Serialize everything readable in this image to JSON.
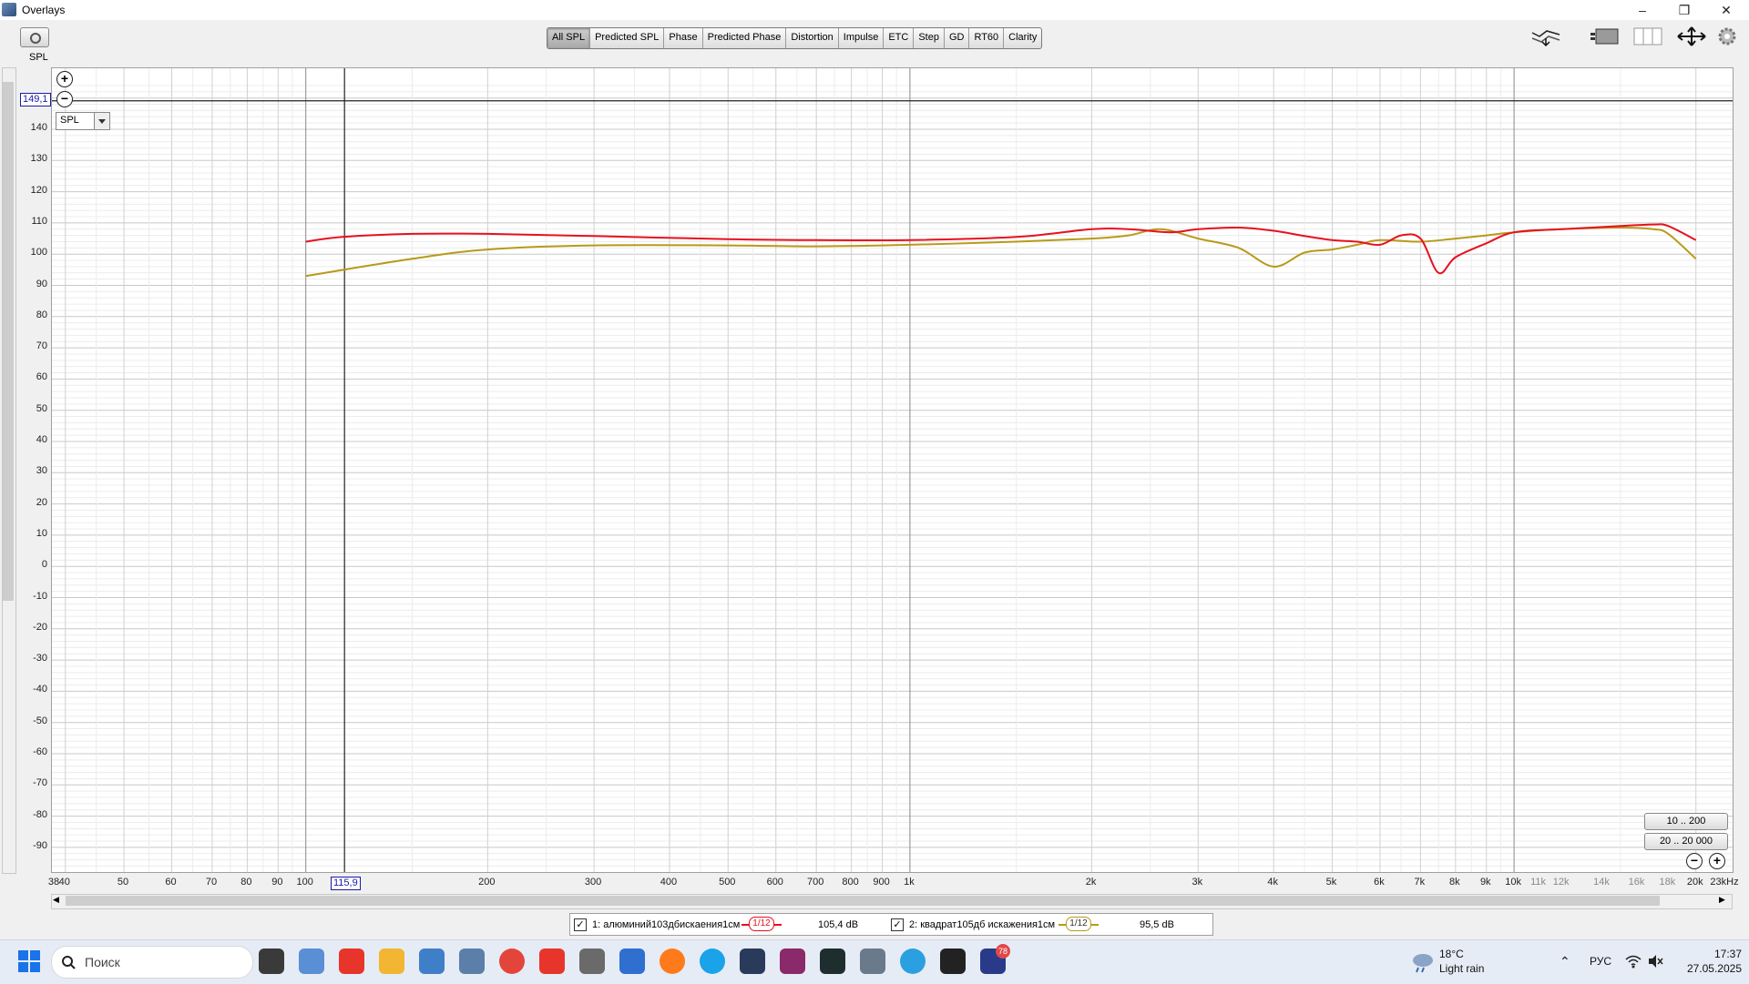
{
  "window": {
    "title": "Overlays"
  },
  "toolbar": {
    "graph_label": "SPL",
    "tabs": [
      {
        "label": "All SPL",
        "active": true
      },
      {
        "label": "Predicted SPL"
      },
      {
        "label": "Phase"
      },
      {
        "label": "Predicted Phase"
      },
      {
        "label": "Distortion"
      },
      {
        "label": "Impulse"
      },
      {
        "label": "ETC"
      },
      {
        "label": "Step"
      },
      {
        "label": "GD"
      },
      {
        "label": "RT60"
      },
      {
        "label": "Clarity"
      }
    ]
  },
  "graph": {
    "cursor_value": "149,1",
    "cursor_freq": "115,9",
    "dropdown_value": "SPL",
    "range_buttons": [
      "10 .. 200",
      "20 .. 20 000"
    ]
  },
  "chart_data": {
    "type": "line",
    "x_scale": "log",
    "xlim": [
      38,
      23000
    ],
    "ylim": [
      -100,
      155
    ],
    "grid": true,
    "yticks": [
      "140",
      "130",
      "120",
      "110",
      "100",
      "90",
      "80",
      "70",
      "60",
      "50",
      "40",
      "30",
      "20",
      "10",
      "0",
      "-10",
      "-20",
      "-30",
      "-40",
      "-50",
      "-60",
      "-70",
      "-80",
      "-90"
    ],
    "xtick_labels": [
      {
        "f": 38,
        "t": "38",
        "minor": false
      },
      {
        "f": 40,
        "t": "40",
        "minor": false
      },
      {
        "f": 50,
        "t": "50",
        "minor": false
      },
      {
        "f": 60,
        "t": "60",
        "minor": false
      },
      {
        "f": 70,
        "t": "70",
        "minor": false
      },
      {
        "f": 80,
        "t": "80",
        "minor": false
      },
      {
        "f": 90,
        "t": "90",
        "minor": false
      },
      {
        "f": 100,
        "t": "100",
        "minor": false
      },
      {
        "f": 200,
        "t": "200",
        "minor": false
      },
      {
        "f": 300,
        "t": "300",
        "minor": false
      },
      {
        "f": 400,
        "t": "400",
        "minor": false
      },
      {
        "f": 500,
        "t": "500",
        "minor": false
      },
      {
        "f": 600,
        "t": "600",
        "minor": false
      },
      {
        "f": 700,
        "t": "700",
        "minor": false
      },
      {
        "f": 800,
        "t": "800",
        "minor": false
      },
      {
        "f": 900,
        "t": "900",
        "minor": false
      },
      {
        "f": 1000,
        "t": "1k",
        "minor": false
      },
      {
        "f": 2000,
        "t": "2k",
        "minor": false
      },
      {
        "f": 3000,
        "t": "3k",
        "minor": false
      },
      {
        "f": 4000,
        "t": "4k",
        "minor": false
      },
      {
        "f": 5000,
        "t": "5k",
        "minor": false
      },
      {
        "f": 6000,
        "t": "6k",
        "minor": false
      },
      {
        "f": 7000,
        "t": "7k",
        "minor": false
      },
      {
        "f": 8000,
        "t": "8k",
        "minor": false
      },
      {
        "f": 9000,
        "t": "9k",
        "minor": false
      },
      {
        "f": 10000,
        "t": "10k",
        "minor": false
      },
      {
        "f": 11000,
        "t": "11k",
        "minor": true
      },
      {
        "f": 12000,
        "t": "12k",
        "minor": true
      },
      {
        "f": 14000,
        "t": "14k",
        "minor": true
      },
      {
        "f": 16000,
        "t": "16k",
        "minor": true
      },
      {
        "f": 18000,
        "t": "18k",
        "minor": true
      },
      {
        "f": 20000,
        "t": "20k",
        "minor": false
      },
      {
        "f": 23000,
        "t": "23kHz",
        "minor": false
      }
    ],
    "series": [
      {
        "name": "1: алюминий103дбискаения1см",
        "color": "#e8101e",
        "x": [
          100,
          115,
          150,
          200,
          300,
          500,
          700,
          1000,
          1500,
          2000,
          2300,
          2700,
          3000,
          3500,
          4000,
          4500,
          5000,
          5500,
          6000,
          6500,
          7000,
          7500,
          8000,
          9000,
          10000,
          12000,
          15000,
          17000,
          18000,
          20000
        ],
        "y": [
          104,
          105.5,
          106.5,
          106.5,
          105.8,
          104.8,
          104.5,
          104.5,
          105.5,
          108,
          108,
          107,
          108,
          108.5,
          107.5,
          105.8,
          104.5,
          104,
          103,
          106,
          105,
          94,
          99,
          103.5,
          107,
          108,
          109,
          109.5,
          109,
          104.5
        ]
      },
      {
        "name": "2: квадрат105дб искажения1см",
        "color": "#b89a1a",
        "x": [
          100,
          150,
          200,
          300,
          500,
          700,
          1000,
          1500,
          2000,
          2300,
          2600,
          3000,
          3500,
          4000,
          4500,
          5000,
          5500,
          6000,
          7000,
          8000,
          9000,
          10000,
          12000,
          15000,
          17000,
          18000,
          20000
        ],
        "y": [
          93,
          98.5,
          101.5,
          102.8,
          102.8,
          102.5,
          103,
          104,
          105,
          106,
          108,
          105,
          102,
          96,
          100.5,
          101.5,
          103,
          104.5,
          104,
          105,
          106,
          107,
          108,
          108.5,
          108,
          106.5,
          98.5
        ]
      }
    ]
  },
  "legend": [
    {
      "check": "✓",
      "label": "1: алюминий103дбискаения1см",
      "smoothing": "1/12",
      "value": "105,4 dB",
      "color": "#e8101e"
    },
    {
      "check": "✓",
      "label": "2: квадрат105дб искажения1см",
      "smoothing": "1/12",
      "value": "95,5 dB",
      "color": "#b89a1a"
    }
  ],
  "taskbar": {
    "search_placeholder": "Поиск",
    "weather_temp": "18°C",
    "weather_desc": "Light rain",
    "lang": "РУС",
    "time": "17:37",
    "date": "27.05.2025",
    "badge": "78",
    "icons": [
      "task-view-icon",
      "notepad-icon",
      "yandex-icon",
      "folder-icon",
      "photos-icon",
      "calculator-icon",
      "chrome-icon",
      "yandex-browser-icon",
      "omega-icon",
      "document-icon",
      "firefox-icon",
      "skype-icon",
      "mixer-icon",
      "audio-app-icon",
      "terminal-icon",
      "settings-icon",
      "telegram-icon",
      "binance-icon",
      "rew-icon"
    ]
  }
}
